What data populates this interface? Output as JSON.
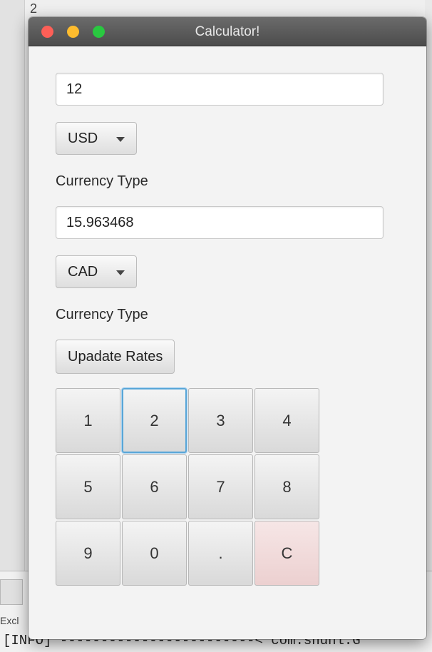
{
  "background": {
    "line_number": "2",
    "console_text_left": "Excl",
    "console_info": "[INFO] ------------------------< com.shunl:G"
  },
  "window": {
    "title": "Calculator!"
  },
  "input_amount": {
    "value": "12"
  },
  "from_currency": {
    "selected": "USD"
  },
  "from_label": "Currency Type",
  "output_amount": {
    "value": "15.963468"
  },
  "to_currency": {
    "selected": "CAD"
  },
  "to_label": "Currency Type",
  "update_button": "Upadate Rates",
  "keypad": {
    "keys": [
      "1",
      "2",
      "3",
      "4",
      "5",
      "6",
      "7",
      "8",
      "9",
      "0",
      ".",
      "C"
    ]
  },
  "colors": {
    "close": "#fd5f57",
    "minimize": "#febc2e",
    "maximize": "#29c840",
    "focus": "#58a6d8",
    "clear_key": "#f6e6e6"
  }
}
